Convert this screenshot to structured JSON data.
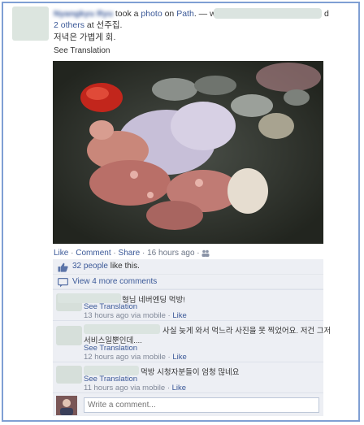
{
  "story": {
    "actor_name": "Nyangkyu Ryu",
    "action_text": "took a",
    "photo_link": "photo",
    "on_text": "on",
    "place_link": "Path",
    "with_text": ". — with",
    "and_suffix": "d",
    "others_link": "2 others",
    "at_text": "at 선주집.",
    "message": "저녁은 가볍게 회.",
    "see_translation": "See Translation"
  },
  "actions": {
    "like": "Like",
    "comment": "Comment",
    "share": "Share",
    "sep": "·",
    "time": "16 hours ago",
    "sep2": "·"
  },
  "likes": {
    "count_link": "32 people",
    "suffix": "like this."
  },
  "more_comments": {
    "label": "View 4 more comments"
  },
  "comments": [
    {
      "text": "형님 네버엔딩 먹방!",
      "translation": "See Translation",
      "time": "13 hours ago via mobile",
      "sep": "·",
      "like": "Like"
    },
    {
      "text": "사실 늦게 와서 먹느라 사진을 못 찍었어요. 저건 그저",
      "text2": "서비스일뿐인데....",
      "translation": "See Translation",
      "time": "12 hours ago via mobile",
      "sep": "·",
      "like": "Like"
    },
    {
      "text": "먹방 시청자분들이 엄청 많네요",
      "translation": "See Translation",
      "time": "11 hours ago via mobile",
      "sep": "·",
      "like": "Like"
    }
  ],
  "compose": {
    "placeholder": "Write a comment..."
  },
  "icons": {
    "thumb": "thumbs-up-icon",
    "bubble": "speech-bubble-icon",
    "people": "audience-icon"
  },
  "colors": {
    "link": "#3b5998",
    "ufi_bg": "#edeff4",
    "frame": "#7f9fd3"
  }
}
